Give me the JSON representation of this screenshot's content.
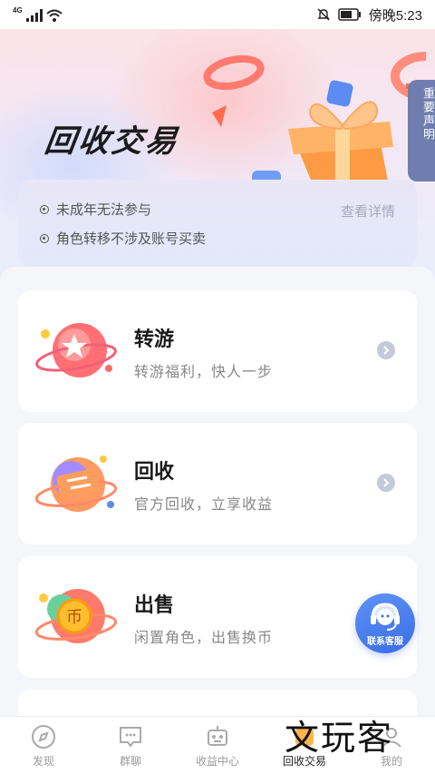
{
  "status_bar": {
    "network": "4G",
    "time": "傍晚5:23"
  },
  "hero": {
    "title": "回收交易",
    "notice_button": "重要声明"
  },
  "notice": {
    "lines": [
      "未成年无法参与",
      "角色转移不涉及账号买卖"
    ],
    "detail_link": "查看详情"
  },
  "cards": [
    {
      "title": "转游",
      "subtitle": "转游福利，快人一步",
      "icon": "star-planet-icon"
    },
    {
      "title": "回收",
      "subtitle": "官方回收，立享收益",
      "icon": "exchange-planet-icon"
    },
    {
      "title": "出售",
      "subtitle": "闲置角色，出售换币",
      "icon": "coin-planet-icon",
      "icon_text": "币"
    }
  ],
  "service_button": {
    "label": "联系客服"
  },
  "tabbar": {
    "tabs": [
      {
        "label": "发现",
        "icon": "compass-icon"
      },
      {
        "label": "群聊",
        "icon": "chat-icon"
      },
      {
        "label": "收益中心",
        "icon": "robot-icon"
      },
      {
        "label": "回收交易",
        "icon": "trade-icon",
        "active": true
      },
      {
        "label": "我的",
        "icon": "profile-icon"
      }
    ]
  },
  "watermark": {
    "text": "文玩客"
  },
  "colors": {
    "accent_blue": "#3b6de4",
    "notice_button": "#6f7eae",
    "gift_orange": "#ff8a3c",
    "ring_pink": "#ff7a6e"
  }
}
